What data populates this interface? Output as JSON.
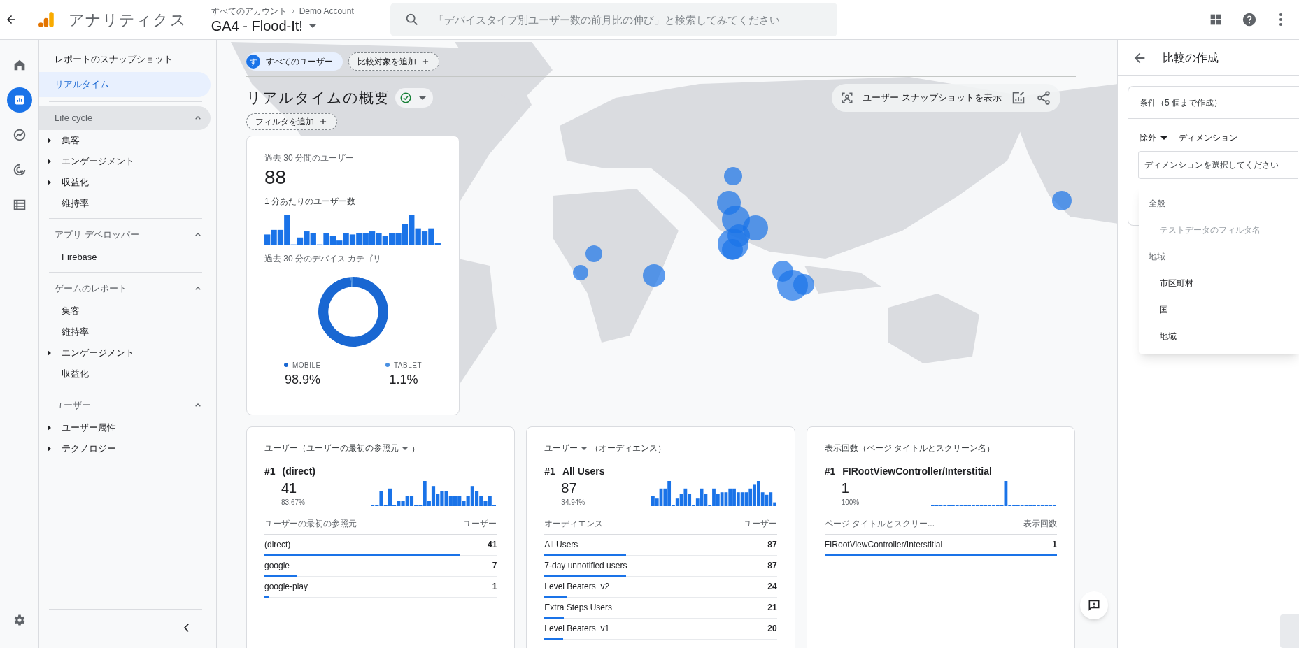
{
  "header": {
    "app_name": "アナリティクス",
    "breadcrumb": [
      "すべてのアカウント",
      "Demo Account"
    ],
    "property": "GA4 - Flood-It!",
    "search_placeholder": "「デバイスタイプ別ユーザー数の前月比の伸び」と検索してみてください"
  },
  "rail": [
    {
      "kind": "home",
      "selected": false
    },
    {
      "kind": "reports",
      "selected": true
    },
    {
      "kind": "explore",
      "selected": false
    },
    {
      "kind": "advertising",
      "selected": false
    },
    {
      "kind": "configure",
      "selected": false
    }
  ],
  "nav": {
    "top_items": [
      {
        "label": "レポートのスナップショット",
        "selected": false
      },
      {
        "label": "リアルタイム",
        "selected": true
      }
    ],
    "sections": [
      {
        "title": "Life cycle",
        "expanded": true,
        "highlighted": true,
        "items": [
          {
            "label": "集客",
            "expandable": true
          },
          {
            "label": "エンゲージメント",
            "expandable": true
          },
          {
            "label": "収益化",
            "expandable": true
          },
          {
            "label": "維持率",
            "expandable": false
          }
        ]
      },
      {
        "title": "アプリ デベロッパー",
        "expanded": true,
        "highlighted": false,
        "items": [
          {
            "label": "Firebase",
            "expandable": false
          }
        ]
      },
      {
        "title": "ゲームのレポート",
        "expanded": true,
        "highlighted": false,
        "items": [
          {
            "label": "集客",
            "expandable": false
          },
          {
            "label": "維持率",
            "expandable": false
          },
          {
            "label": "エンゲージメント",
            "expandable": true
          },
          {
            "label": "収益化",
            "expandable": false
          }
        ]
      },
      {
        "title": "ユーザー",
        "expanded": true,
        "highlighted": false,
        "items": [
          {
            "label": "ユーザー属性",
            "expandable": true
          },
          {
            "label": "テクノロジー",
            "expandable": true
          }
        ]
      }
    ]
  },
  "segment": {
    "initial": "す",
    "label": "すべてのユーザー",
    "add_comparison": "比較対象を追加"
  },
  "title": "リアルタイムの概要",
  "add_filter": "フィルタを追加",
  "snapshot_button": "ユーザー スナップショットを表示",
  "realtime_card": {
    "users_label": "過去 30 分間のユーザー",
    "users_value": "88",
    "per_minute_label": "1 分あたりのユーザー数",
    "device_label": "過去 30 分のデバイス カテゴリ",
    "chart_data": {
      "type": "donut",
      "categories": [
        "MOBILE",
        "TABLET"
      ],
      "values": [
        98.9,
        1.1
      ],
      "value_labels": [
        "98.9%",
        "1.1%"
      ],
      "legend": "bottom"
    }
  },
  "cards": [
    {
      "metric": "ユーザー",
      "metric_dropdown": false,
      "dimension": "（ユーザーの最初の参照元",
      "dimension_dropdown": true,
      "dimension_end": "）",
      "rank": "#1",
      "top_label": "(direct)",
      "top_value": "41",
      "top_share": "83.67%",
      "col_1": "ユーザーの最初の参照元",
      "col_2": "ユーザー",
      "rows": [
        {
          "label": "(direct)",
          "value": "41",
          "level": 0.84
        },
        {
          "label": "google",
          "value": "7",
          "level": 0.14
        },
        {
          "label": "google-play",
          "value": "1",
          "level": 0.02
        }
      ]
    },
    {
      "metric": "ユーザー",
      "metric_dropdown": true,
      "dimension": "（オーディエンス",
      "dimension_dropdown": false,
      "dimension_end": "）",
      "rank": "#1",
      "top_label": "All Users",
      "top_value": "87",
      "top_share": "34.94%",
      "col_1": "オーディエンス",
      "col_2": "ユーザー",
      "rows": [
        {
          "label": "All Users",
          "value": "87",
          "level": 0.35
        },
        {
          "label": "7-day unnotified users",
          "value": "87",
          "level": 0.35
        },
        {
          "label": "Level Beaters_v2",
          "value": "24",
          "level": 0.094
        },
        {
          "label": "Extra Steps Users",
          "value": "21",
          "level": 0.084
        },
        {
          "label": "Level Beaters_v1",
          "value": "20",
          "level": 0.08
        }
      ]
    },
    {
      "metric": "表示回数",
      "metric_dropdown": false,
      "dimension": "（ページ タイトルとスクリーン名",
      "dimension_dropdown": false,
      "dimension_end": "）",
      "rank": "#1",
      "top_label": "FIRootViewController/Interstitial",
      "top_value": "1",
      "top_share": "100%",
      "col_1": "ページ タイトルとスクリー...",
      "col_2": "表示回数",
      "rows": [
        {
          "label": "FIRootViewController/Interstitial",
          "value": "1",
          "level": 1
        }
      ]
    }
  ],
  "panel": {
    "title": "比較の作成",
    "conditions_label": "条件（5 個まで作成）",
    "mode": "除外",
    "type_label": "ディメンション",
    "field_placeholder": "ディメンションを選択してください",
    "menu": [
      {
        "label": "全般",
        "items": [
          {
            "label": "テストデータのフィルタ名",
            "disabled": true
          }
        ]
      },
      {
        "label": "地域",
        "items": [
          {
            "label": "市区町村",
            "disabled": false
          },
          {
            "label": "国",
            "disabled": false
          },
          {
            "label": "地域",
            "disabled": false
          }
        ]
      }
    ]
  }
}
